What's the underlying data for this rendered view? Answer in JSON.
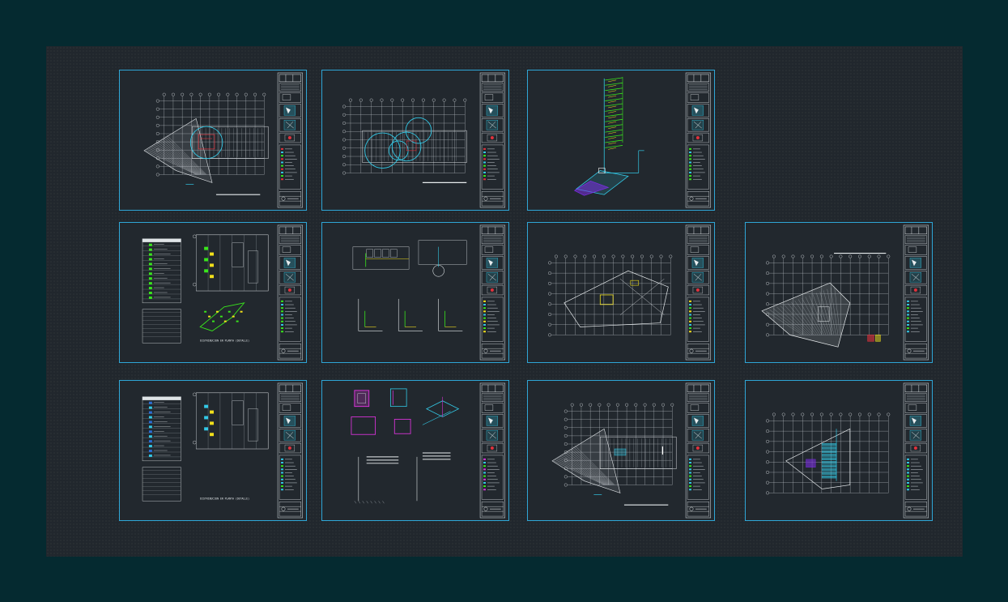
{
  "colors": {
    "outer_background": "#052a30",
    "model_space": "#21272d",
    "sheet_border": "#2fa6d6",
    "grid_line": "#b9c0c6",
    "accent_cyan": "#33c9e6",
    "accent_red": "#e0323c",
    "accent_green": "#39e61c",
    "accent_yellow": "#f2e01b",
    "accent_magenta": "#d633d6",
    "accent_purple": "#7a2de0"
  },
  "sheets": [
    {
      "name": "sheet-floor-plan-grid-red",
      "kind": "plan",
      "accent": "red"
    },
    {
      "name": "sheet-floor-plan-circles",
      "kind": "plan-circles",
      "accent": "red"
    },
    {
      "name": "sheet-riser-isometric",
      "kind": "riser",
      "accent": "green"
    },
    {
      "name": "sheet-detail-table-green",
      "kind": "detail-table",
      "accent": "green",
      "caption": "DISTRIBUCION EN PLANTA (DETALLE)"
    },
    {
      "name": "sheet-section-details",
      "kind": "sections",
      "accent": "yellow"
    },
    {
      "name": "sheet-site-plan-outline",
      "kind": "site",
      "accent": "yellow"
    },
    {
      "name": "sheet-site-plan-filled",
      "kind": "site-filled",
      "accent": "cyan"
    },
    {
      "name": "sheet-detail-table-blue",
      "kind": "detail-table-blue",
      "accent": "cyan",
      "caption": "DISTRIBUCION EN PLANTA (DETALLE)"
    },
    {
      "name": "sheet-magenta-details",
      "kind": "magenta-details",
      "accent": "magenta"
    },
    {
      "name": "sheet-floor-plan-grid-blue",
      "kind": "plan",
      "accent": "cyan"
    },
    {
      "name": "sheet-site-plan-stairs",
      "kind": "site-stairs",
      "accent": "cyan"
    }
  ]
}
